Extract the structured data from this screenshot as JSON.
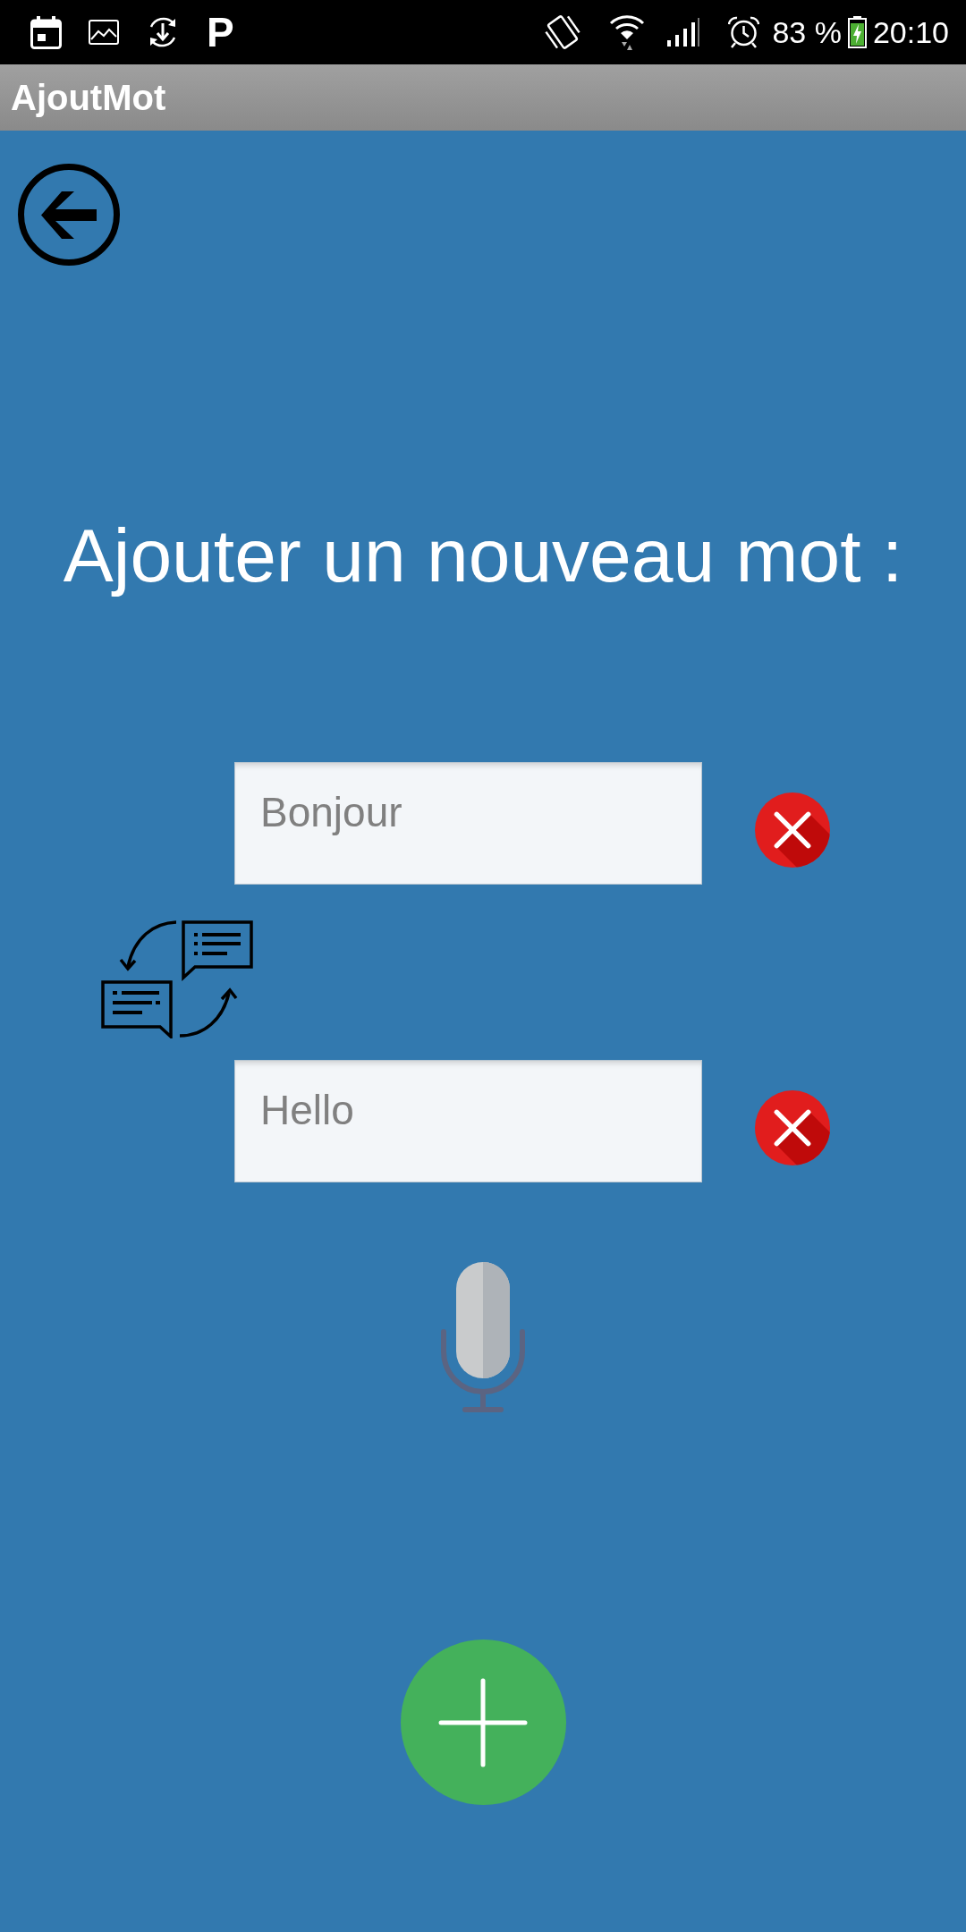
{
  "status_bar": {
    "notification_letter": "P",
    "battery_percent": "83 %",
    "time": "20:10"
  },
  "app_bar": {
    "title": "AjoutMot"
  },
  "heading": "Ajouter un nouveau mot :",
  "word_fields": [
    {
      "placeholder": "Bonjour"
    },
    {
      "placeholder": "Hello"
    }
  ]
}
